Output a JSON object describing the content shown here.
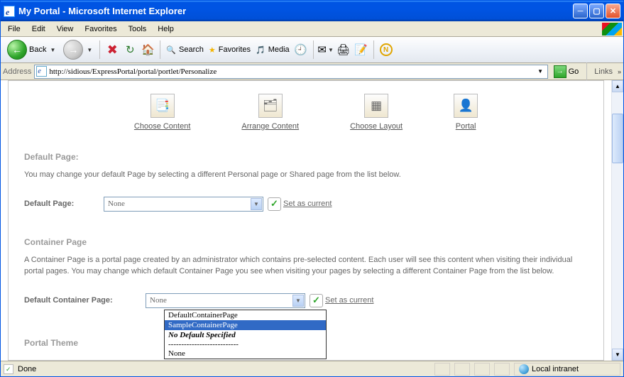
{
  "window": {
    "title": "My Portal - Microsoft Internet Explorer"
  },
  "menu": {
    "file": "File",
    "edit": "Edit",
    "view": "View",
    "favorites": "Favorites",
    "tools": "Tools",
    "help": "Help"
  },
  "toolbar": {
    "back": "Back",
    "search": "Search",
    "favorites": "Favorites",
    "media": "Media"
  },
  "address": {
    "label": "Address",
    "url": "http://sidious/ExpressPortal/portal/portlet/Personalize",
    "go": "Go",
    "links": "Links"
  },
  "topnav": {
    "choose_content": "Choose Content",
    "arrange_content": "Arrange Content",
    "choose_layout": "Choose Layout",
    "portal": "Portal"
  },
  "default_page": {
    "heading": "Default Page:",
    "desc": "You may change your default Page by selecting a different Personal page or Shared page from the list below.",
    "label": "Default Page:",
    "value": "None",
    "action": "Set as current"
  },
  "container": {
    "heading": "Container Page",
    "desc": "A Container Page is a portal page created by an administrator which contains pre-selected content. Each user will see this content when visiting their individual portal pages. You may change which default Container Page you see when visiting your pages by selecting a different Container Page from the list below.",
    "label": "Default Container Page:",
    "value": "None",
    "action": "Set as current",
    "options": {
      "o1": "DefaultContainerPage",
      "o2": "SampleContainerPage",
      "hdr": "No Default Specified",
      "div": "---------------------------",
      "o3": "None"
    }
  },
  "portal_theme": {
    "heading": "Portal Theme"
  },
  "status": {
    "done": "Done",
    "zone": "Local intranet"
  }
}
